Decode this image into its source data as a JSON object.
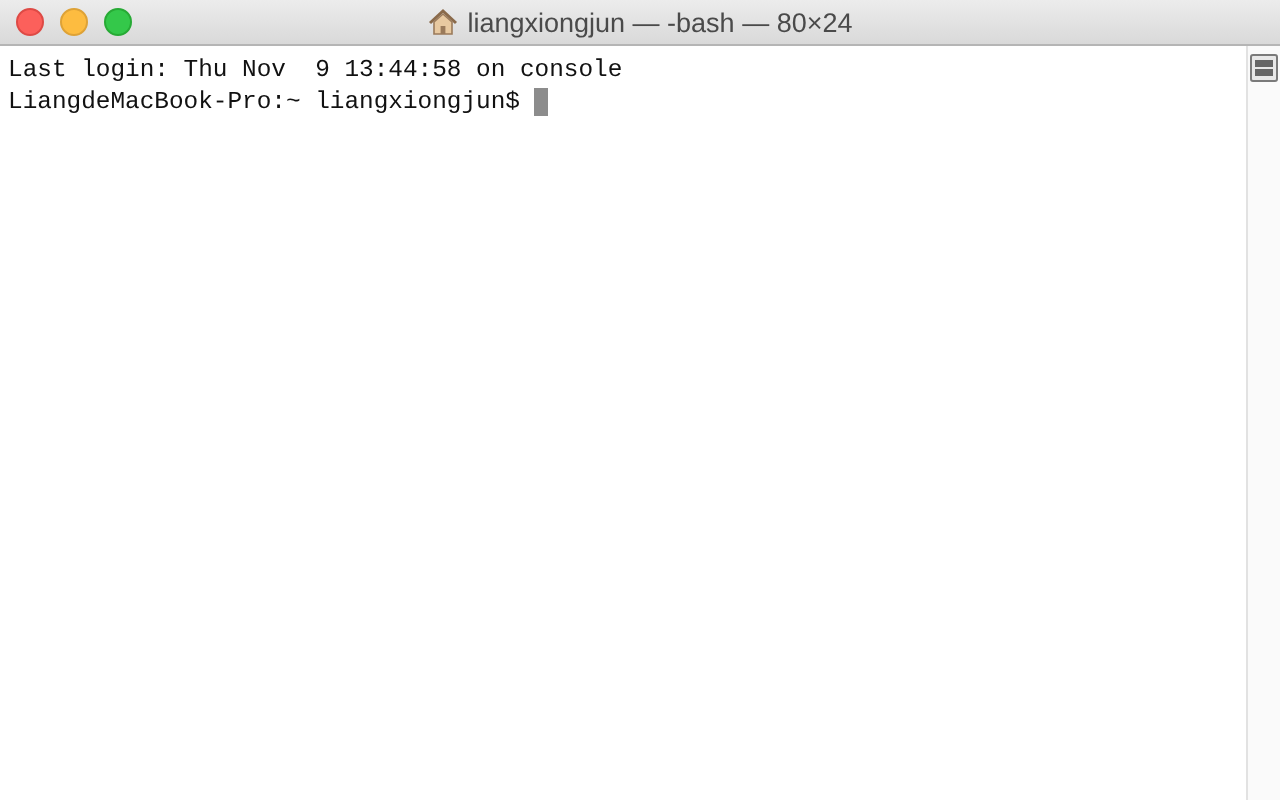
{
  "window": {
    "title": "liangxiongjun — -bash — 80×24"
  },
  "terminal": {
    "lines": [
      "Last login: Thu Nov  9 13:44:58 on console",
      "LiangdeMacBook-Pro:~ liangxiongjun$ "
    ],
    "cursor": true
  }
}
